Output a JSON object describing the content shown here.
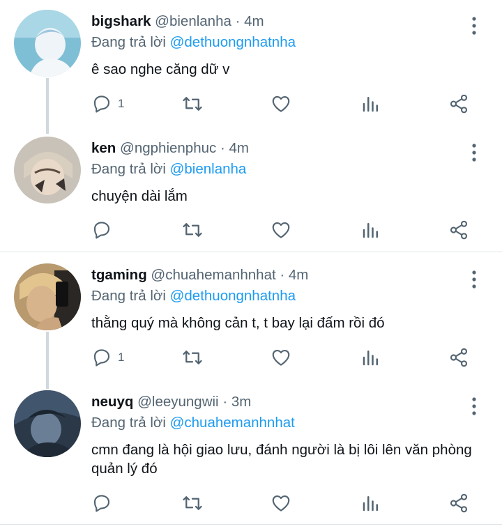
{
  "tweets": [
    {
      "name": "bigshark",
      "handle": "@bienlanha",
      "dot": "·",
      "time": "4m",
      "replying_prefix": "Đang trả lời",
      "replying_to": "@dethuongnhatnha",
      "text": "ê sao nghe căng dữ v",
      "reply_count": "1"
    },
    {
      "name": "ken",
      "handle": "@ngphienphuc",
      "dot": "·",
      "time": "4m",
      "replying_prefix": "Đang trả lời",
      "replying_to": "@bienlanha",
      "text": "chuyện dài lắm",
      "reply_count": ""
    },
    {
      "name": "tgaming",
      "handle": "@chuahemanhnhat",
      "dot": "·",
      "time": "4m",
      "replying_prefix": "Đang trả lời",
      "replying_to": "@dethuongnhatnha",
      "text": "thằng quý mà không cản t, t bay lại đấm rồi đó",
      "reply_count": "1"
    },
    {
      "name": "neuyq",
      "handle": "@leeyungwii",
      "dot": "·",
      "time": "3m",
      "replying_prefix": "Đang trả lời",
      "replying_to": "@chuahemanhnhat",
      "text": "cmn đang là hội giao lưu, đánh người là bị lôi lên văn phòng quản lý đó",
      "reply_count": ""
    }
  ],
  "colors": {
    "accent": "#1d9bf0",
    "secondary_text": "#536471",
    "thread_line": "#cfd9de"
  }
}
